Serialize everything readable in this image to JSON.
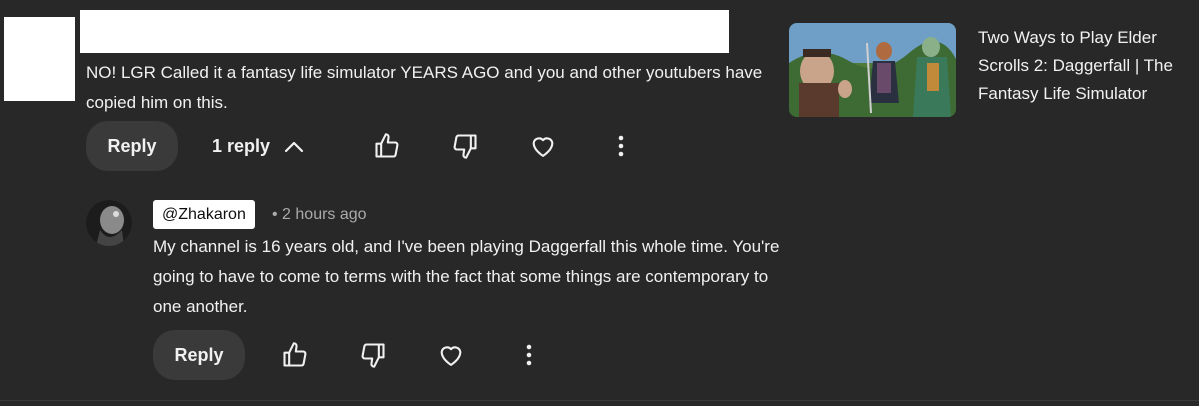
{
  "top_comment": {
    "text": "NO! LGR Called it a fantasy life simulator YEARS AGO and you and other youtubers have copied him on this.",
    "reply_label": "Reply",
    "replies_toggle_label": "1 reply"
  },
  "video": {
    "title": "Two Ways to Play Elder Scrolls 2: Daggerfall | The Fantasy Life Simulator"
  },
  "reply": {
    "handle": "@Zhakaron",
    "time": "• 2 hours ago",
    "text": "My channel is 16 years old, and I've been playing Daggerfall this whole time. You're going to have to come to terms with the fact that some things are contemporary to one another.",
    "reply_label": "Reply"
  },
  "colors": {
    "background": "#282828",
    "pill": "#3a3a3a",
    "text": "#f1f1f1",
    "muted": "#aaaaaa"
  }
}
